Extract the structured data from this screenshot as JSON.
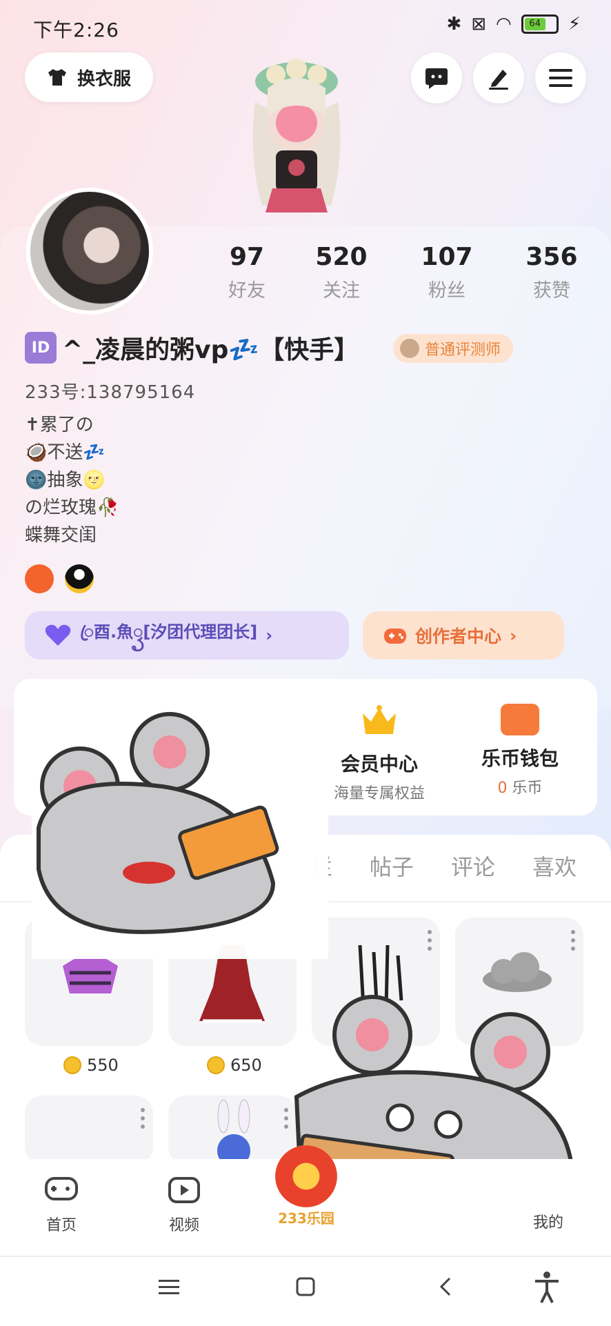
{
  "status_bar": {
    "time": "下午2:26",
    "battery": "64"
  },
  "header": {
    "outfit_label": "换衣服"
  },
  "stats": [
    {
      "value": "97",
      "label": "好友"
    },
    {
      "value": "520",
      "label": "关注"
    },
    {
      "value": "107",
      "label": "粉丝"
    },
    {
      "value": "356",
      "label": "获赞"
    }
  ],
  "profile": {
    "id_badge": "ID",
    "name": "^_凌晨的粥vp💤【快手】",
    "tester_badge": "普通评测师",
    "uid": "233号:138795164",
    "bio": [
      "✝累了の",
      "🥥不送💤",
      "🌚抽象🌝",
      "の烂玫瑰🥀",
      "蝶舞交闺"
    ]
  },
  "team_button": {
    "label": "ꦿ酉.魚ꦽ[汐团代理团长]"
  },
  "creator_button": {
    "label": "创作者中心"
  },
  "features": [
    {
      "title": "会员中心",
      "subtitle": "海量专属权益"
    },
    {
      "title": "乐币钱包",
      "value": "0",
      "unit": "乐币"
    }
  ],
  "tabs": [
    "栏",
    "帖子",
    "评论",
    "喜欢"
  ],
  "items": [
    {
      "price": "550"
    },
    {
      "price": "650"
    }
  ],
  "bottom_nav": [
    {
      "label": "首页",
      "icon": "gamepad-icon"
    },
    {
      "label": "视频",
      "icon": "video-icon"
    },
    {
      "label": "233乐园",
      "icon": "center-logo"
    },
    {
      "label": "我的",
      "icon": "profile-icon"
    }
  ],
  "colors": {
    "accent_orange": "#e8703a",
    "accent_purple": "#5c4cb8",
    "coin": "#f5c02e"
  }
}
